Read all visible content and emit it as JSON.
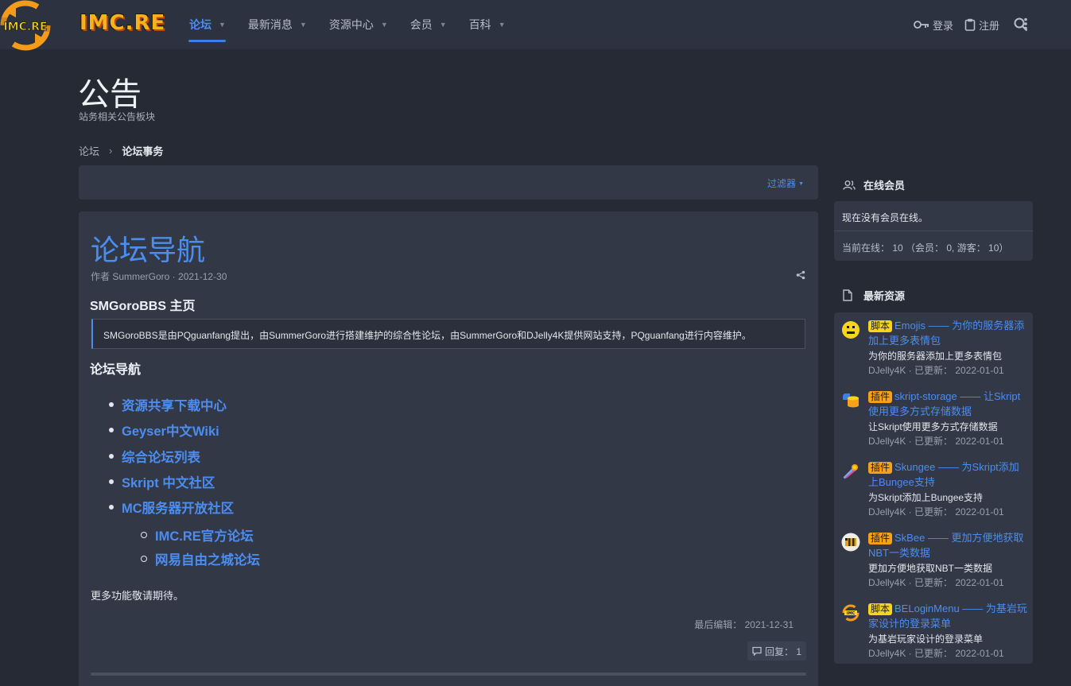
{
  "header": {
    "logo_text": "IMC.RE",
    "nav": [
      {
        "label": "论坛",
        "active": true
      },
      {
        "label": "最新消息",
        "active": false
      },
      {
        "label": "资源中心",
        "active": false
      },
      {
        "label": "会员",
        "active": false
      },
      {
        "label": "百科",
        "active": false
      }
    ],
    "login_label": "登录",
    "register_label": "注册"
  },
  "page": {
    "title": "公告",
    "description": "站务相关公告板块",
    "breadcrumb": [
      "论坛",
      "论坛事务"
    ]
  },
  "filter": {
    "label": "过滤器"
  },
  "post": {
    "title": "论坛导航",
    "meta": "作者 SummerGoro · 2021-12-30",
    "home_heading": "SMGoroBBS 主页",
    "quote": "SMGoroBBS是由PQguanfang提出，由SummerGoro进行搭建维护的综合性论坛，由SummerGoro和DJelly4K提供网站支持，PQguanfang进行内容维护。",
    "nav_heading": "论坛导航",
    "links": [
      "资源共享下载中心",
      "Geyser中文Wiki",
      "综合论坛列表",
      "Skript 中文社区",
      "MC服务器开放社区"
    ],
    "sub_links": [
      "IMC.RE官方论坛",
      "网易自由之城论坛"
    ],
    "more_text": "更多功能敬请期待。",
    "last_edit": "最后编辑： 2021-12-31",
    "reply_label": "回复： 1"
  },
  "sidebar": {
    "online_heading": "在线会员",
    "online_none": "现在没有会员在线。",
    "online_stats": "当前在线： 10 （会员： 0, 游客： 10）",
    "resources_heading": "最新资源",
    "resources": [
      {
        "badge": "脚本",
        "badge_type": "script",
        "title": "Emojis —— 为你的服务器添加上更多表情包",
        "desc": "为你的服务器添加上更多表情包",
        "meta": "DJelly4K · 已更新： 2022-01-01",
        "icon": "emoji-face-icon"
      },
      {
        "badge": "插件",
        "badge_type": "plugin",
        "title": "skript-storage —— 让Skript使用更多方式存储数据",
        "desc": "让Skript使用更多方式存储数据",
        "meta": "DJelly4K · 已更新： 2022-01-01",
        "icon": "database-icon"
      },
      {
        "badge": "插件",
        "badge_type": "plugin",
        "title": "Skungee —— 为Skript添加上Bungee支持",
        "desc": "为Skript添加上Bungee支持",
        "meta": "DJelly4K · 已更新： 2022-01-01",
        "icon": "comet-icon"
      },
      {
        "badge": "插件",
        "badge_type": "plugin",
        "title": "SkBee —— 更加方便地获取NBT一类数据",
        "desc": "更加方便地获取NBT一类数据",
        "meta": "DJelly4K · 已更新： 2022-01-01",
        "icon": "bee-icon"
      },
      {
        "badge": "脚本",
        "badge_type": "script",
        "title": "BELoginMenu —— 为基岩玩家设计的登录菜单",
        "desc": "为基岩玩家设计的登录菜单",
        "meta": "DJelly4K · 已更新： 2022-01-01",
        "icon": "imc-logo-icon"
      }
    ]
  },
  "colors": {
    "accent": "#4c8df0",
    "background": "#252a35",
    "panel": "#323846",
    "script_badge": "#f7d51d",
    "plugin_badge": "#f5a11a"
  }
}
